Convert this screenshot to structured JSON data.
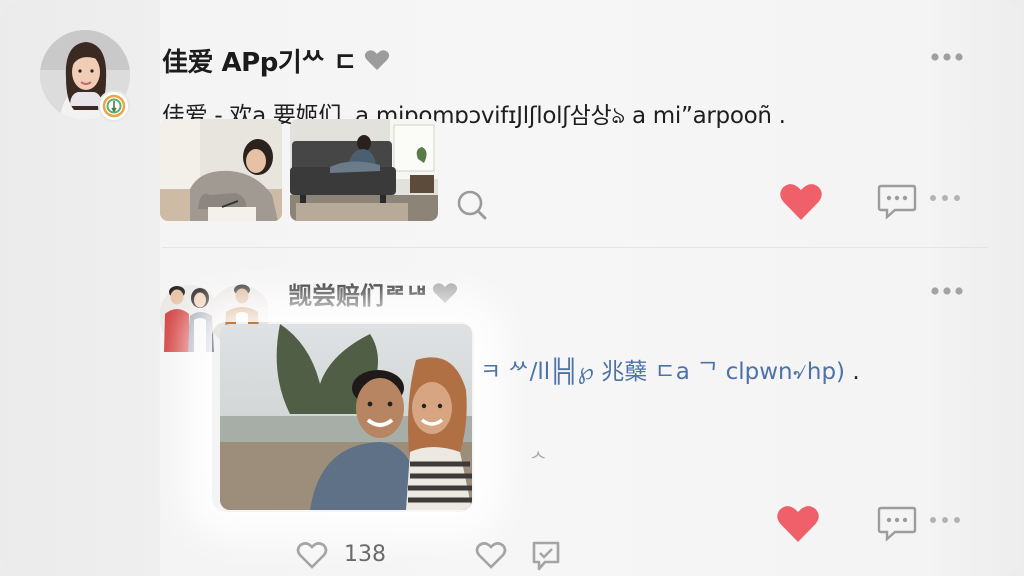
{
  "post1": {
    "author": "佳爱 APp기ᄊ ㄷ",
    "caption": "佳爱 - 欢a 要姬们,   a mipomɒɔvifɪJlʃlolʃ삼상ঌ a mi”arpooñ .",
    "icons": [
      "verified-badge-icon",
      "heart-icon",
      "more-dots-icon",
      "search-icon",
      "like-heart-icon",
      "comment-icon"
    ]
  },
  "post2": {
    "author": "觊尝赔们ᄙᄖ",
    "caption_prefix": "ㅋ ᄽ/ll╠╣℘ 兆蘖 ㄷ",
    "caption_link": "a ᄀ clpwn৵hp)",
    "caption_suffix": " .",
    "small_mark": "ᄉ",
    "like_count": "138",
    "icons": [
      "heart-icon",
      "more-dots-icon",
      "like-heart-icon",
      "comment-icon",
      "like-outline-icon",
      "reply-icon",
      "chat-bubble-icon"
    ]
  },
  "colors": {
    "heart": "#f0606a",
    "accent_blue": "#4d72a8",
    "icon_gray": "#a8a8a8"
  }
}
